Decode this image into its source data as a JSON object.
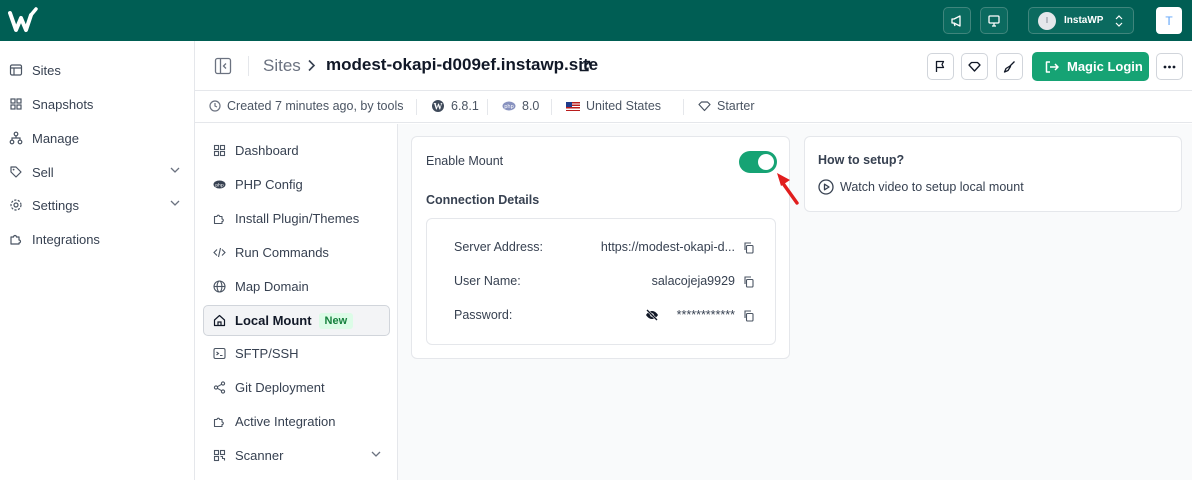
{
  "topbar": {
    "logo_icon": "instawp-logo-icon",
    "account_initial": "I",
    "account_name": "InstaWP",
    "user_initial": "T"
  },
  "sidebar": {
    "items": [
      {
        "label": "Sites",
        "icon": "sites-icon"
      },
      {
        "label": "Snapshots",
        "icon": "grid-icon"
      },
      {
        "label": "Manage",
        "icon": "sitemap-icon"
      },
      {
        "label": "Sell",
        "icon": "tag-icon"
      },
      {
        "label": "Settings",
        "icon": "gear-icon"
      },
      {
        "label": "Integrations",
        "icon": "puzzle-icon"
      }
    ]
  },
  "header": {
    "breadcrumb_root": "Sites",
    "site_name": "modest-okapi-d009ef.instawp.site",
    "magic_login_label": "Magic Login"
  },
  "info": {
    "created": "Created 7 minutes ago, by tools",
    "wp_version": "6.8.1",
    "php_version": "8.0",
    "region": "United States",
    "plan": "Starter"
  },
  "subnav": {
    "items": [
      {
        "label": "Dashboard"
      },
      {
        "label": "PHP Config"
      },
      {
        "label": "Install Plugin/Themes"
      },
      {
        "label": "Run Commands"
      },
      {
        "label": "Map Domain"
      },
      {
        "label": "Local Mount",
        "badge": "New",
        "active": true
      },
      {
        "label": "SFTP/SSH"
      },
      {
        "label": "Git Deployment"
      },
      {
        "label": "Active Integration"
      },
      {
        "label": "Scanner"
      }
    ]
  },
  "mount": {
    "enable_label": "Enable Mount",
    "enabled": true,
    "connection_title": "Connection Details",
    "server_label": "Server Address:",
    "server_value": "https://modest-okapi-d...",
    "user_label": "User Name:",
    "user_value": "salacojeja9929",
    "password_label": "Password:",
    "password_value": "************"
  },
  "setup": {
    "title": "How to setup?",
    "link": "Watch video to setup local mount"
  },
  "colors": {
    "brand_dark": "#005E54",
    "accent_green": "#16a374",
    "annotation_red": "#e11d1d"
  }
}
